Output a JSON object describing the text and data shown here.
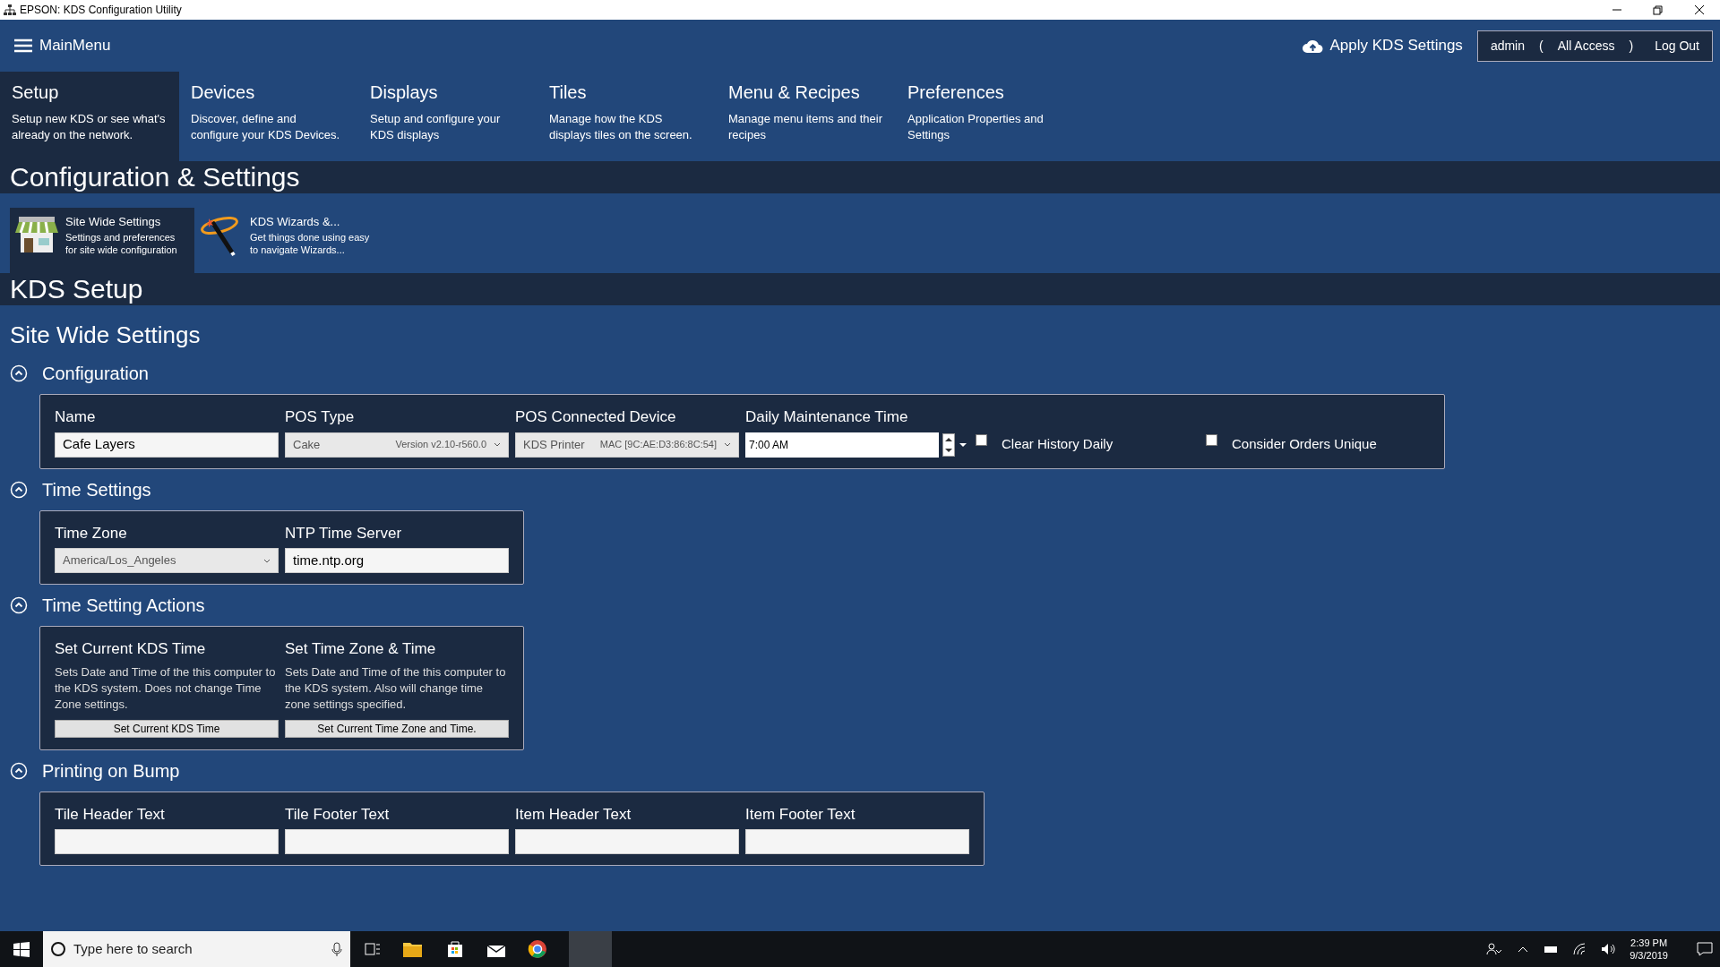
{
  "window": {
    "title": "EPSON: KDS Configuration Utility"
  },
  "header": {
    "menu_label": "MainMenu",
    "apply_label": "Apply KDS Settings",
    "user": "admin",
    "paren_open": "(",
    "role": "All Access",
    "paren_close": ")",
    "logout": "Log Out"
  },
  "nav": [
    {
      "title": "Setup",
      "description": "Setup new KDS or see what's already on the network.",
      "selected": true
    },
    {
      "title": "Devices",
      "description": "Discover, define and configure your KDS Devices.",
      "selected": false
    },
    {
      "title": "Displays",
      "description": "Setup and configure your KDS displays",
      "selected": false
    },
    {
      "title": "Tiles",
      "description": "Manage how the KDS displays tiles on the screen.",
      "selected": false
    },
    {
      "title": "Menu & Recipes",
      "description": "Manage menu items and their recipes",
      "selected": false
    },
    {
      "title": "Preferences",
      "description": "Application Properties and Settings",
      "selected": false
    }
  ],
  "page_title": "Configuration & Settings",
  "toolbar": [
    {
      "kind": "store",
      "title": "Site Wide Settings",
      "description": "Settings and preferences for site wide configuration",
      "selected": true
    },
    {
      "kind": "wand",
      "title": "KDS Wizards &...",
      "description": "Get things done using easy to navigate Wizards...",
      "selected": false
    }
  ],
  "band_title": "KDS Setup",
  "content_title": "Site Wide Settings",
  "sections": [
    {
      "title": "Configuration",
      "expanded": true,
      "items": [
        {
          "kind": "text",
          "label": "Name",
          "value": "Cafe Layers"
        },
        {
          "kind": "select",
          "label": "POS Type",
          "value": "Cake",
          "detail": "Version v2.10-r560.0"
        },
        {
          "kind": "select",
          "label": "POS Connected Device",
          "value": "KDS Printer",
          "detail": "MAC [9C:AE:D3:86:8C:54]"
        },
        {
          "kind": "time",
          "label": "Daily Maintenance Time",
          "value": "7:00 AM"
        },
        {
          "kind": "checkbox",
          "label": "Clear History Daily",
          "checked": false
        },
        {
          "kind": "checkbox",
          "label": "Consider Orders Unique",
          "checked": false
        }
      ]
    },
    {
      "title": "Time Settings",
      "expanded": true,
      "items": [
        {
          "kind": "select",
          "label": "Time Zone",
          "value": "America/Los_Angeles"
        },
        {
          "kind": "text",
          "label": "NTP Time Server",
          "value": "time.ntp.org"
        }
      ]
    },
    {
      "title": "Time Setting Actions",
      "expanded": true,
      "items": [
        {
          "kind": "action",
          "label": "Set Current KDS Time",
          "description": "Sets Date and Time of the this computer to the KDS system. Does not change Time Zone settings.",
          "button": "Set Current KDS Time"
        },
        {
          "kind": "action",
          "label": "Set Time Zone & Time",
          "description": "Sets Date and Time of the this computer to the KDS system. Also will change time zone settings specified.",
          "button": "Set Current Time Zone and Time."
        }
      ]
    },
    {
      "title": "Printing on Bump",
      "expanded": true,
      "items": [
        {
          "kind": "text",
          "label": "Tile Header Text"
        },
        {
          "kind": "text",
          "label": "Tile Footer Text"
        },
        {
          "kind": "text",
          "label": "Item Header Text"
        },
        {
          "kind": "text",
          "label": "Item Footer Text"
        }
      ]
    }
  ],
  "taskbar": {
    "search_placeholder": "Type here to search",
    "time": "2:39 PM",
    "date": "9/3/2019"
  }
}
